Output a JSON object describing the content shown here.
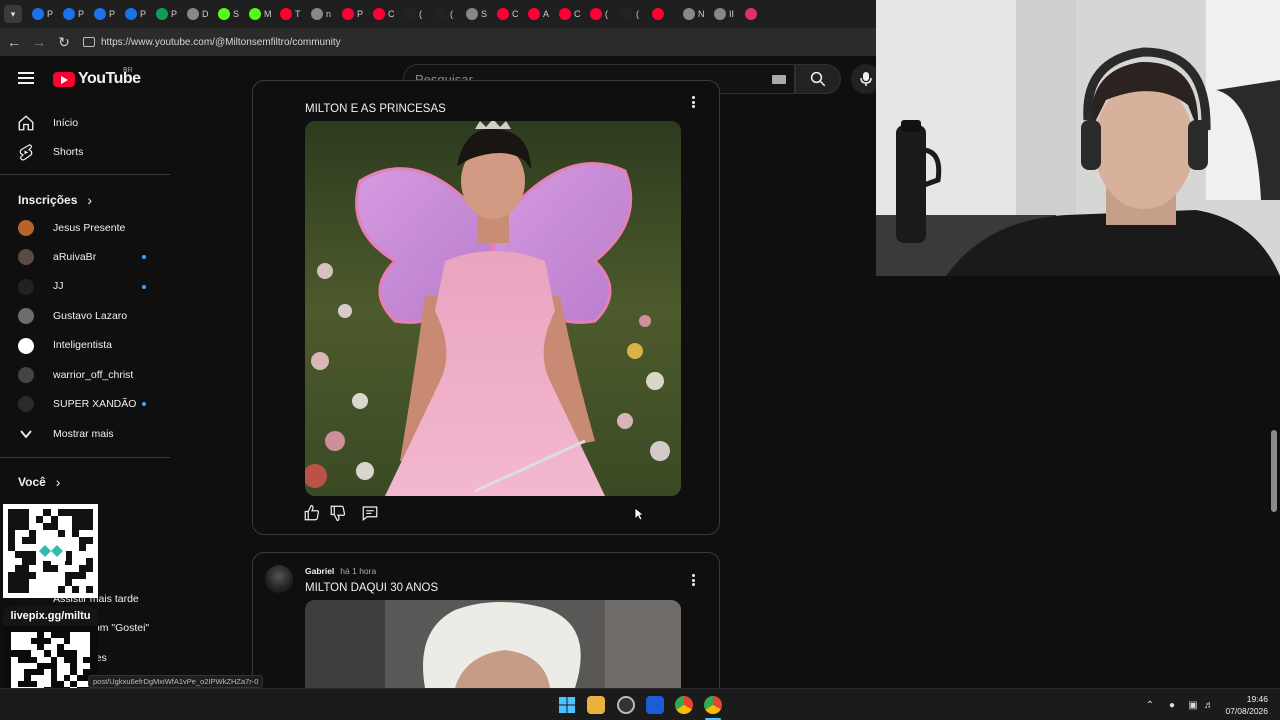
{
  "browser": {
    "tabs": [
      {
        "icon": "p-icon",
        "letter": "P",
        "color": "#1a73e8"
      },
      {
        "icon": "p-icon",
        "letter": "P",
        "color": "#1a73e8"
      },
      {
        "icon": "p-icon",
        "letter": "P",
        "color": "#1a73e8"
      },
      {
        "icon": "p-icon",
        "letter": "P",
        "color": "#1a73e8"
      },
      {
        "icon": "code-icon",
        "letter": "P",
        "color": "#0f9d58"
      },
      {
        "icon": "globe-icon",
        "letter": "D",
        "color": "#888888"
      },
      {
        "icon": "k-icon",
        "letter": "S",
        "color": "#53fc18"
      },
      {
        "icon": "k-icon",
        "letter": "M",
        "color": "#53fc18"
      },
      {
        "icon": "youtube-icon",
        "letter": "T",
        "color": "#ff0033"
      },
      {
        "icon": "globe-icon",
        "letter": "n",
        "color": "#888888"
      },
      {
        "icon": "youtube-icon",
        "letter": "P",
        "color": "#ff0033"
      },
      {
        "icon": "youtube-icon",
        "letter": "C",
        "color": "#ff0033"
      },
      {
        "icon": "tiktok-icon",
        "letter": "(",
        "color": "#222222"
      },
      {
        "icon": "tiktok-icon",
        "letter": "(",
        "color": "#222222"
      },
      {
        "icon": "globe-icon",
        "letter": "S",
        "color": "#888888"
      },
      {
        "icon": "youtube-icon",
        "letter": "C",
        "color": "#ff0033"
      },
      {
        "icon": "youtube-icon",
        "letter": "A",
        "color": "#ff0033"
      },
      {
        "icon": "youtube-icon",
        "letter": "C",
        "color": "#ff0033"
      },
      {
        "icon": "youtube-icon",
        "letter": "(",
        "color": "#ff0033"
      },
      {
        "icon": "tiktok-icon",
        "letter": "(",
        "color": "#222222"
      },
      {
        "icon": "youtube-icon",
        "letter": "",
        "color": "#ff0033"
      },
      {
        "icon": "globe-icon",
        "letter": "N",
        "color": "#888888"
      },
      {
        "icon": "globe-icon",
        "letter": "II",
        "color": "#888888"
      },
      {
        "icon": "instagram-icon",
        "letter": "",
        "color": "#e1306c"
      }
    ],
    "url": "https://www.youtube.com/@Miltonsemfiltro/community"
  },
  "masthead": {
    "logo_text": "YouTube",
    "country": "BR",
    "search_placeholder": "Pesquisar"
  },
  "sidebar": {
    "nav": [
      {
        "label": "Início",
        "icon": "home-icon"
      },
      {
        "label": "Shorts",
        "icon": "shorts-icon"
      }
    ],
    "subs_heading": "Inscrições",
    "subscriptions": [
      {
        "name": "Jesus Presente",
        "avatar_color": "#b5652a",
        "new": false
      },
      {
        "name": "aRuivaBr",
        "avatar_color": "#5a4a44",
        "new": true
      },
      {
        "name": "JJ",
        "avatar_color": "#222222",
        "new": true
      },
      {
        "name": "Gustavo Lazaro",
        "avatar_color": "#6d6d6d",
        "new": false
      },
      {
        "name": "Inteligentista",
        "avatar_color": "#ffffff",
        "new": false
      },
      {
        "name": "warrior_off_christ",
        "avatar_color": "#444444",
        "new": false
      },
      {
        "name": "SUPER XANDÃO",
        "avatar_color": "#2a2a2a",
        "new": true
      }
    ],
    "show_more": "Mostrar mais",
    "you_heading": "Você",
    "you_items": [
      {
        "label": "Assistir mais tarde"
      },
      {
        "label": "Vídeos com \"Gostei\""
      },
      {
        "label": "Seus clipes"
      }
    ]
  },
  "overlay": {
    "pix_url": "livepix.gg/miltu"
  },
  "posts": [
    {
      "title": "MILTON E AS PRINCESAS",
      "image_alt": "fairy-princess-image"
    },
    {
      "author": "Gabriel",
      "time": "há 1 hora",
      "title": "MILTON DAQUI 30 ANOS",
      "image_alt": "old-man-white-hair-image"
    }
  ],
  "status_bar_url": "post/Ugkxu6efrDgMxiWfA1vPe_o2IPWkZHZa7r-0",
  "taskbar": {
    "time": "19:46",
    "date": "07/08/2026"
  }
}
